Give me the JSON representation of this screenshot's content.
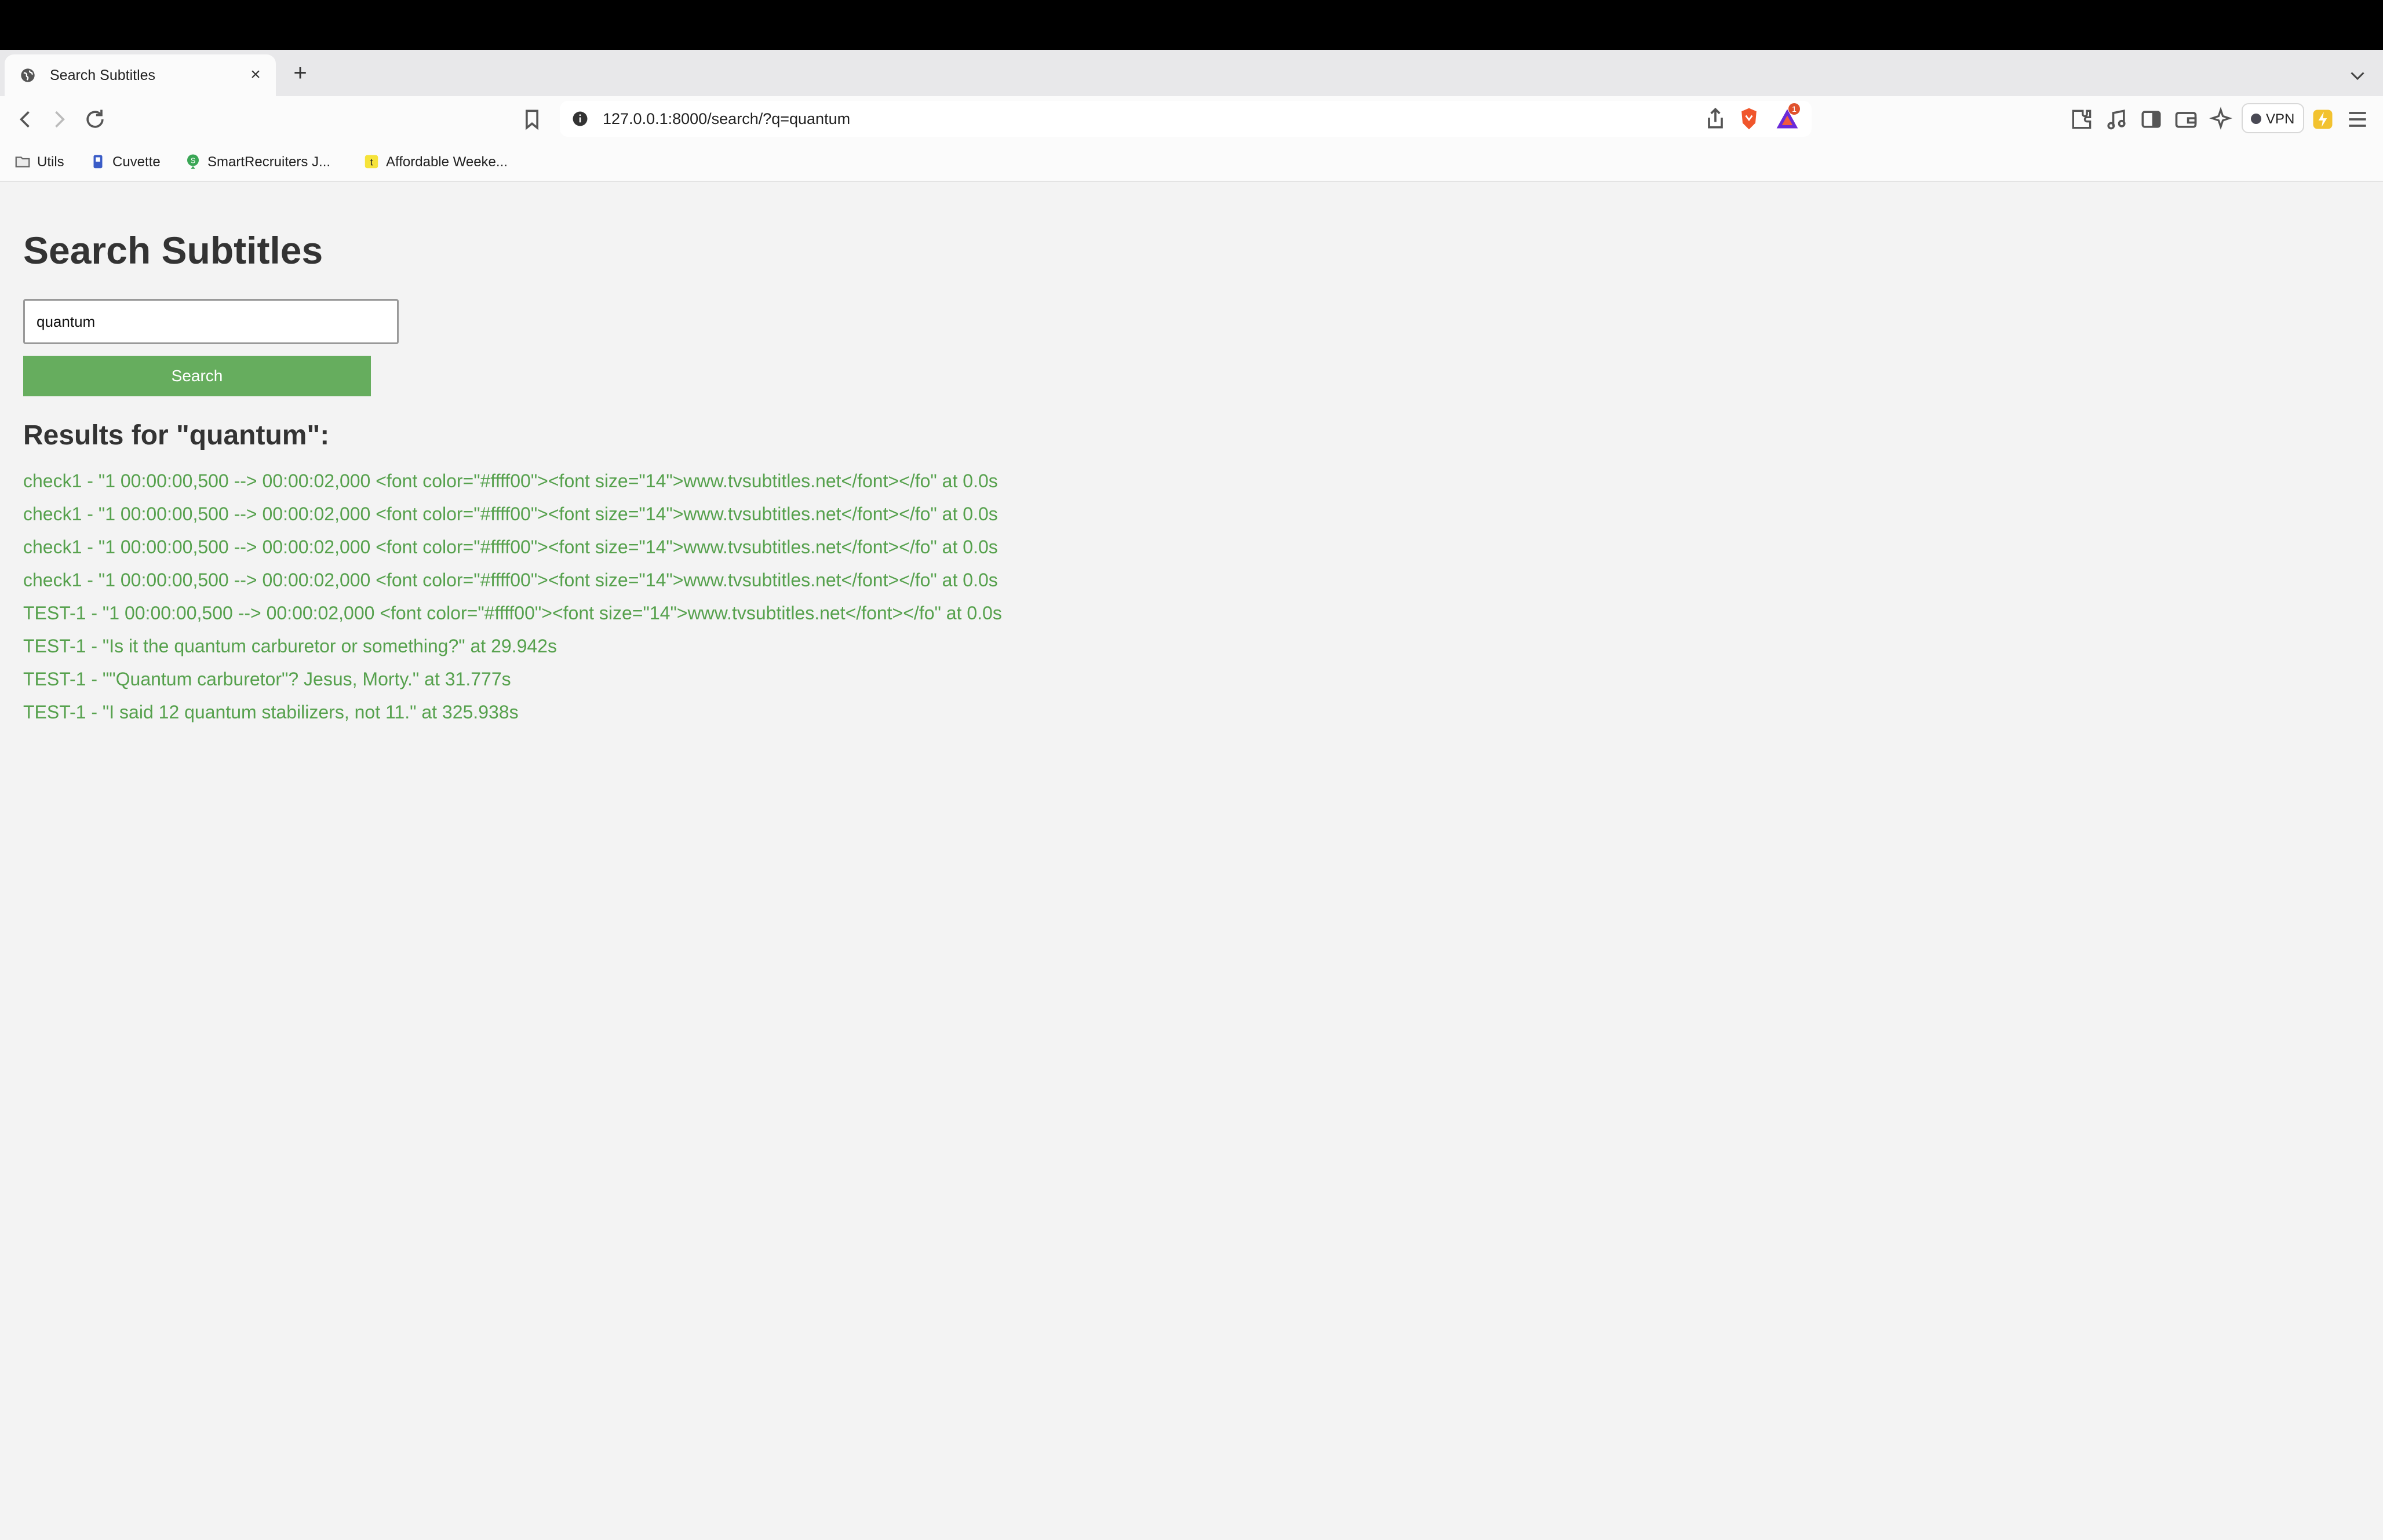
{
  "browser": {
    "tab": {
      "title": "Search Subtitles",
      "favicon": "globe-icon",
      "close_symbol": "×"
    },
    "new_tab_symbol": "+",
    "address_bar": {
      "url": "127.0.0.1:8000/search/?q=quantum"
    },
    "notification_count": "1",
    "vpn_label": "VPN",
    "bookmarks": [
      {
        "label": "Utils",
        "icon": "folder-icon"
      },
      {
        "label": "Cuvette",
        "icon": "cuvette-favicon"
      },
      {
        "label": "SmartRecruiters J...",
        "icon": "smartrecruiters-favicon"
      },
      {
        "label": "Affordable Weeke...",
        "icon": "t-favicon"
      }
    ]
  },
  "page": {
    "title": "Search Subtitles",
    "search": {
      "value": "quantum",
      "button_label": "Search"
    },
    "results_heading": "Results for \"quantum\":",
    "results": [
      "check1 - \"1 00:00:00,500 --> 00:00:02,000 <font color=\"#ffff00\"><font size=\"14\">www.tvsubtitles.net</font></fo\" at 0.0s",
      "check1 - \"1 00:00:00,500 --> 00:00:02,000 <font color=\"#ffff00\"><font size=\"14\">www.tvsubtitles.net</font></fo\" at 0.0s",
      "check1 - \"1 00:00:00,500 --> 00:00:02,000 <font color=\"#ffff00\"><font size=\"14\">www.tvsubtitles.net</font></fo\" at 0.0s",
      "check1 - \"1 00:00:00,500 --> 00:00:02,000 <font color=\"#ffff00\"><font size=\"14\">www.tvsubtitles.net</font></fo\" at 0.0s",
      "TEST-1 - \"1 00:00:00,500 --> 00:00:02,000 <font color=\"#ffff00\"><font size=\"14\">www.tvsubtitles.net</font></fo\" at 0.0s",
      "TEST-1 - \"Is it the quantum carburetor or something?\" at 29.942s",
      "TEST-1 - \"\"Quantum carburetor\"? Jesus, Morty.\" at 31.777s",
      "TEST-1 - \"I said 12 quantum stabilizers, not 11.\" at 325.938s"
    ]
  },
  "colors": {
    "accent_green": "#66ad5e",
    "result_text": "#56a14d",
    "page_background": "#f3f3f3"
  }
}
